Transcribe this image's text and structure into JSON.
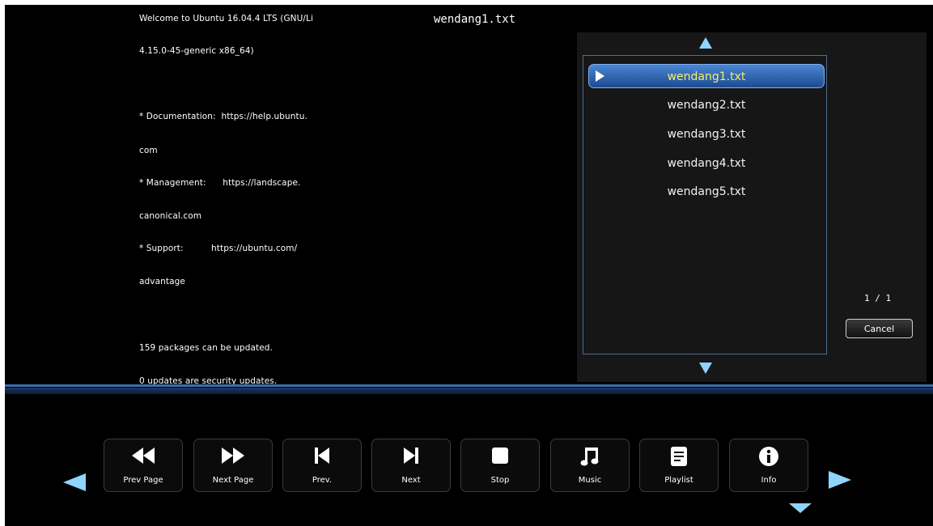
{
  "viewer": {
    "title": "wendang1.txt",
    "lines": [
      "Welcome to Ubuntu 16.04.4 LTS (GNU/Li",
      "4.15.0-45-generic x86_64)",
      "* Documentation:  https://help.ubuntu.",
      "com",
      "* Management:      https://landscape.",
      "canonical.com",
      "* Support:          https://ubuntu.com/",
      "advantage",
      "159 packages can be updated.",
      "0 updates are security updates."
    ]
  },
  "file_list": {
    "items": [
      "wendang1.txt",
      "wendang2.txt",
      "wendang3.txt",
      "wendang4.txt",
      "wendang5.txt"
    ],
    "selected_index": 0,
    "page_indicator": "1 / 1",
    "cancel_label": "Cancel"
  },
  "toolbar": {
    "buttons": [
      {
        "label": "Prev Page",
        "icon": "fast-rewind-icon"
      },
      {
        "label": "Next Page",
        "icon": "fast-forward-icon"
      },
      {
        "label": "Prev.",
        "icon": "skip-previous-icon"
      },
      {
        "label": "Next",
        "icon": "skip-next-icon"
      },
      {
        "label": "Stop",
        "icon": "stop-icon"
      },
      {
        "label": "Music",
        "icon": "music-note-icon"
      },
      {
        "label": "Playlist",
        "icon": "playlist-icon"
      },
      {
        "label": "Info",
        "icon": "info-icon"
      }
    ]
  },
  "colors": {
    "accent": "#8fd4ff",
    "selected_bg": "#2a62b0",
    "selected_text": "#f3ef72"
  }
}
